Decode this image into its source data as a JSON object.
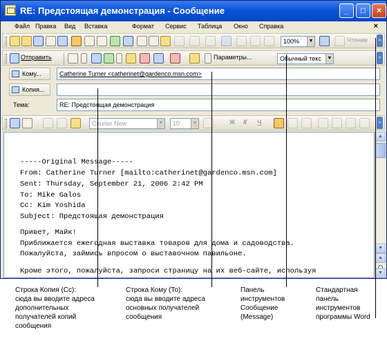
{
  "window": {
    "title": "RE: Предстоящая демонстрация - Сообщение"
  },
  "menubar": {
    "items": [
      "Файл",
      "Правка",
      "Вид",
      "Вставка",
      "Формат",
      "Сервис",
      "Таблица",
      "Окно",
      "Справка"
    ],
    "close_glyph": "×"
  },
  "standard_toolbar": {
    "zoom": "100%",
    "read_label": "Чтение"
  },
  "message_toolbar": {
    "send_label": "Отправить",
    "options_label": "Параметры...",
    "style_value": "Обычный текс"
  },
  "fields": {
    "to_label": "Кому...",
    "to_value": "Catherine Turner <catherinet@gardenco.msn.com>",
    "cc_label": "Копия...",
    "cc_value": "",
    "subject_label": "Тема:",
    "subject_value": "RE: Предстоящая демонстрация"
  },
  "formatting_toolbar": {
    "font": "Courier New",
    "size": "10",
    "bold": "Ж",
    "italic": "К",
    "underline": "Ч"
  },
  "message_body": {
    "lines": [
      "-----Original Message-----",
      "From: Catherine Turner [mailto:catherinet@gardenco.msn.com]",
      "Sent: Thursday, September 21, 2006 2:42 PM",
      "To: Mike Galos",
      "Cc: Kim Yoshida",
      "Subject: Предстоящая демонстрация",
      "",
      "Привет, Майк!",
      "Приближается ежегодная выставка товаров для дома и садоводства.",
      "Пожалуйста, займись впросом о выставочном павильоне.",
      "",
      "Кроме этого, пожалуйста, запроси страницу на их веб-сайте, используя"
    ]
  },
  "captions": [
    {
      "lines": [
        "Строка Копия (Cc):",
        "сюда вы вводите адреса",
        "дополнительных",
        "получателей копий",
        "сообщения"
      ]
    },
    {
      "lines": [
        "Строка Кому (To):",
        "сюда вы вводите адреса",
        "основных получателей",
        "сообщения"
      ]
    },
    {
      "lines": [
        "Панель",
        "инструментов",
        "Сообщение",
        "(Message)"
      ]
    },
    {
      "lines": [
        "Стандартная",
        "панель",
        "инструментов",
        "программы Word"
      ]
    }
  ],
  "colors": {
    "titlebar": "#0a55d8",
    "window_bg": "#ece9d8",
    "active_button": "#f7c66b"
  }
}
